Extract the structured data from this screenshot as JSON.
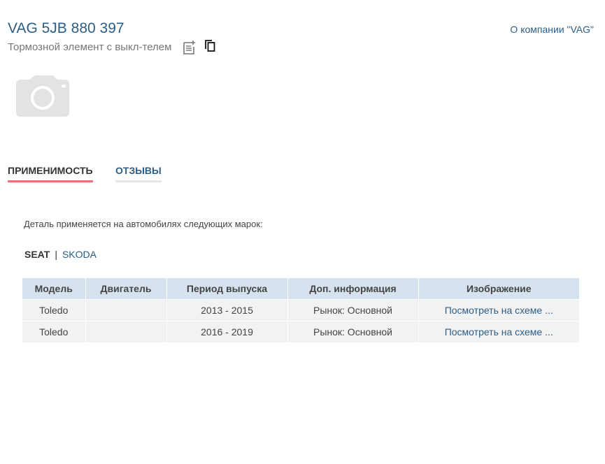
{
  "header": {
    "title": "VAG 5JB 880 397",
    "description": "Тормозной элемент с выкл-телем",
    "company_link": "О компании \"VAG\""
  },
  "icons": {
    "note": "note-add-icon",
    "copy": "copy-icon",
    "photo": "camera-placeholder-icon"
  },
  "tabs": [
    {
      "label": "ПРИМЕНИМОСТЬ",
      "active": true
    },
    {
      "label": "ОТЗЫВЫ",
      "active": false
    }
  ],
  "applicability": {
    "intro": "Деталь применяется на автомобилях следующих марок:",
    "brands": [
      {
        "label": "SEAT",
        "active": true
      },
      {
        "label": "SKODA",
        "active": false
      }
    ],
    "separator": "|",
    "table": {
      "columns": [
        "Модель",
        "Двигатель",
        "Период выпуска",
        "Доп. информация",
        "Изображение"
      ],
      "rows": [
        {
          "model": "Toledo",
          "engine": "",
          "period": "2013 - 2015",
          "info": "Рынок: Основной",
          "image_link": "Посмотреть на схеме ..."
        },
        {
          "model": "Toledo",
          "engine": "",
          "period": "2016 - 2019",
          "info": "Рынок: Основной",
          "image_link": "Посмотреть на схеме ..."
        }
      ]
    }
  },
  "colors": {
    "link": "#2c5d86",
    "active_tab_underline": "#e8737d",
    "table_header_bg": "#d6e3ef",
    "table_row_bg": "#f2f2f2"
  }
}
